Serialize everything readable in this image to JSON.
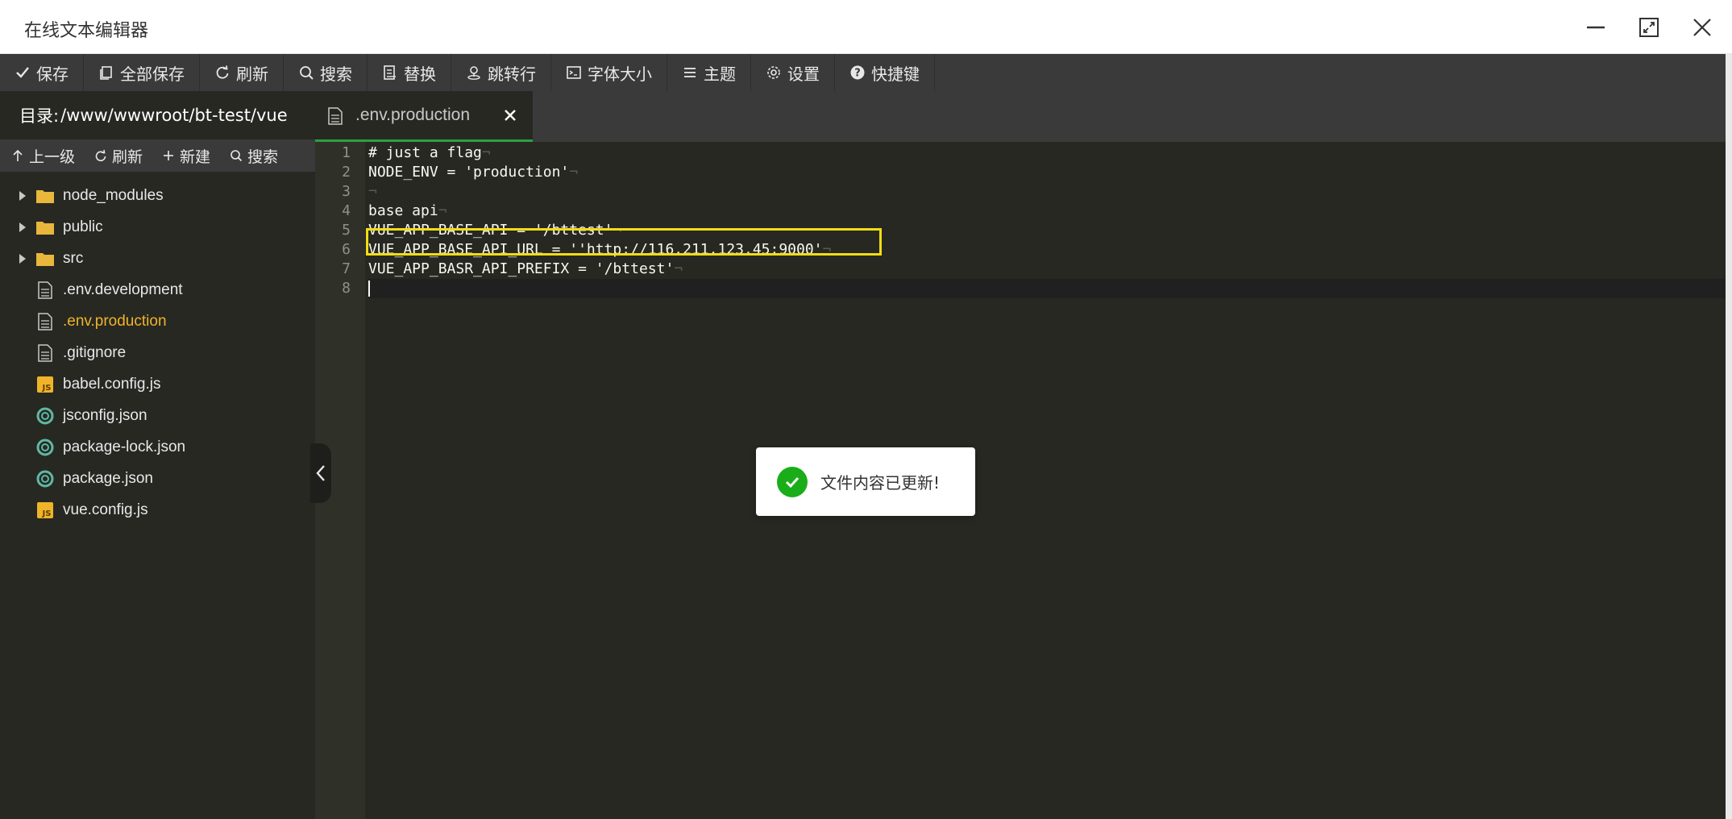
{
  "window": {
    "title": "在线文本编辑器"
  },
  "toolbar": {
    "items": [
      {
        "label": "保存",
        "icon": "check-icon"
      },
      {
        "label": "全部保存",
        "icon": "copy-icon"
      },
      {
        "label": "刷新",
        "icon": "refresh-icon"
      },
      {
        "label": "搜索",
        "icon": "search-icon"
      },
      {
        "label": "替换",
        "icon": "replace-icon"
      },
      {
        "label": "跳转行",
        "icon": "location-icon"
      },
      {
        "label": "字体大小",
        "icon": "terminal-icon"
      },
      {
        "label": "主题",
        "icon": "menu-icon"
      },
      {
        "label": "设置",
        "icon": "gear-icon"
      },
      {
        "label": "快捷键",
        "icon": "help-icon"
      }
    ]
  },
  "sidebar": {
    "dir_label": "目录:",
    "dir_path": "/www/wwwroot/bt-test/vue",
    "tools": [
      {
        "label": "上一级",
        "icon": "arrow-up-icon"
      },
      {
        "label": "刷新",
        "icon": "refresh-icon"
      },
      {
        "label": "新建",
        "icon": "plus-icon"
      },
      {
        "label": "搜索",
        "icon": "search-icon"
      }
    ],
    "tree": [
      {
        "name": "node_modules",
        "type": "folder"
      },
      {
        "name": "public",
        "type": "folder"
      },
      {
        "name": "src",
        "type": "folder"
      },
      {
        "name": ".env.development",
        "type": "file"
      },
      {
        "name": ".env.production",
        "type": "file",
        "active": true
      },
      {
        "name": ".gitignore",
        "type": "file"
      },
      {
        "name": "babel.config.js",
        "type": "js"
      },
      {
        "name": "jsconfig.json",
        "type": "json"
      },
      {
        "name": "package-lock.json",
        "type": "json"
      },
      {
        "name": "package.json",
        "type": "json"
      },
      {
        "name": "vue.config.js",
        "type": "js"
      }
    ]
  },
  "editor": {
    "tab_label": ".env.production",
    "lines": [
      {
        "num": "1",
        "text": "# just a flag"
      },
      {
        "num": "2",
        "text": "NODE_ENV = 'production'"
      },
      {
        "num": "3",
        "text": ""
      },
      {
        "num": "4",
        "text": "base api"
      },
      {
        "num": "5",
        "text": "VUE_APP_BASE_API = '/bttest'"
      },
      {
        "num": "6",
        "text": "VUE_APP_BASE_API_URL = ''http://116.211.123.45:9000'"
      },
      {
        "num": "7",
        "text": "VUE_APP_BASR_API_PREFIX = '/bttest'"
      },
      {
        "num": "8",
        "text": ""
      }
    ]
  },
  "toast": {
    "message": "文件内容已更新!"
  },
  "colors": {
    "toolbar_bg": "#3a3a3a",
    "editor_bg": "#272822",
    "active_file": "#f0b429",
    "tab_underline": "#2ea043",
    "highlight_box": "#f2dc14",
    "toast_ok": "#1aad19"
  }
}
